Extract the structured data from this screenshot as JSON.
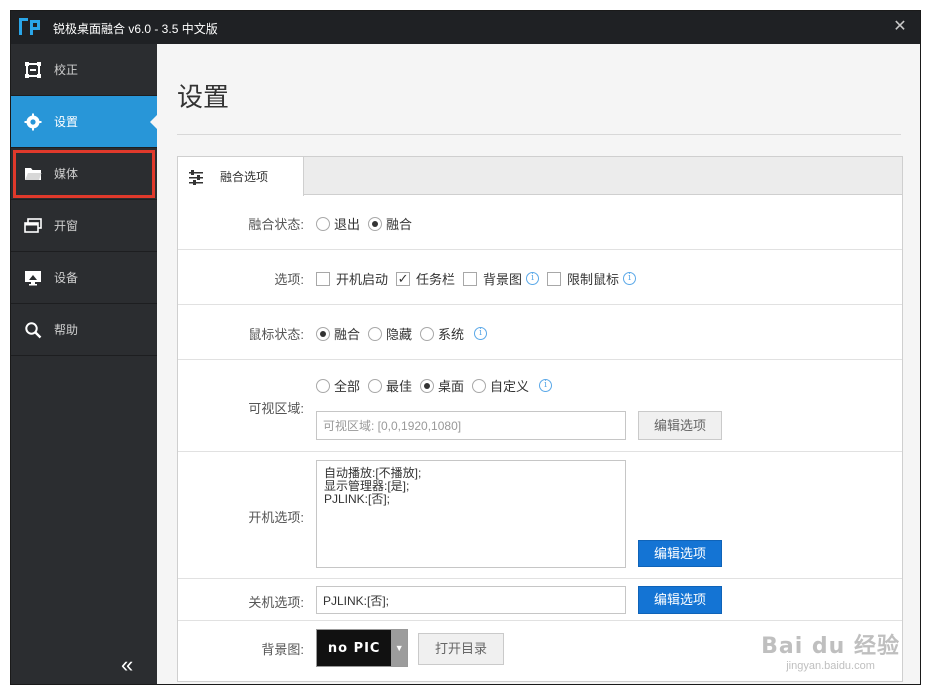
{
  "window": {
    "title": "锐极桌面融合 v6.0 - 3.5 中文版",
    "close": "✕"
  },
  "sidebar": {
    "items": [
      {
        "label": "校正",
        "icon": "calibrate-icon"
      },
      {
        "label": "设置",
        "icon": "gear-icon",
        "active": true
      },
      {
        "label": "媒体",
        "icon": "folder-icon",
        "highlighted": true
      },
      {
        "label": "开窗",
        "icon": "windows-icon"
      },
      {
        "label": "设备",
        "icon": "monitor-icon"
      },
      {
        "label": "帮助",
        "icon": "search-icon"
      }
    ],
    "collapse": "«"
  },
  "main": {
    "page_title": "设置",
    "tab": {
      "label": "融合选项",
      "icon": "sliders-icon"
    },
    "fusion_state": {
      "label": "融合状态:",
      "options": [
        {
          "label": "退出",
          "checked": false
        },
        {
          "label": "融合",
          "checked": true
        }
      ]
    },
    "options_row": {
      "label": "选项:",
      "options": [
        {
          "label": "开机启动",
          "checked": false
        },
        {
          "label": "任务栏",
          "checked": true
        },
        {
          "label": "背景图",
          "checked": false
        },
        {
          "label": "限制鼠标",
          "checked": false
        }
      ],
      "check_mark": "✓",
      "info": "i"
    },
    "mouse_state": {
      "label": "鼠标状态:",
      "options": [
        {
          "label": "融合",
          "checked": true
        },
        {
          "label": "隐藏",
          "checked": false
        },
        {
          "label": "系统",
          "checked": false
        }
      ]
    },
    "visible_area": {
      "label": "可视区域:",
      "options": [
        {
          "label": "全部",
          "checked": false
        },
        {
          "label": "最佳",
          "checked": false
        },
        {
          "label": "桌面",
          "checked": true
        },
        {
          "label": "自定义",
          "checked": false
        }
      ],
      "field_value": "可视区域: [0,0,1920,1080]",
      "edit_button": "编辑选项"
    },
    "boot_options": {
      "label": "开机选项:",
      "value": "自动播放:[不播放];\n显示管理器:[是];\nPJLINK:[否];",
      "edit_button": "编辑选项"
    },
    "shutdown_options": {
      "label": "关机选项:",
      "value": "PJLINK:[否];",
      "edit_button": "编辑选项"
    },
    "background": {
      "label": "背景图:",
      "preview_text": "no PIC",
      "dropdown": "▼",
      "open_button": "打开目录"
    }
  },
  "watermark": {
    "main": "Bai du 经验",
    "sub": "jingyan.baidu.com"
  }
}
